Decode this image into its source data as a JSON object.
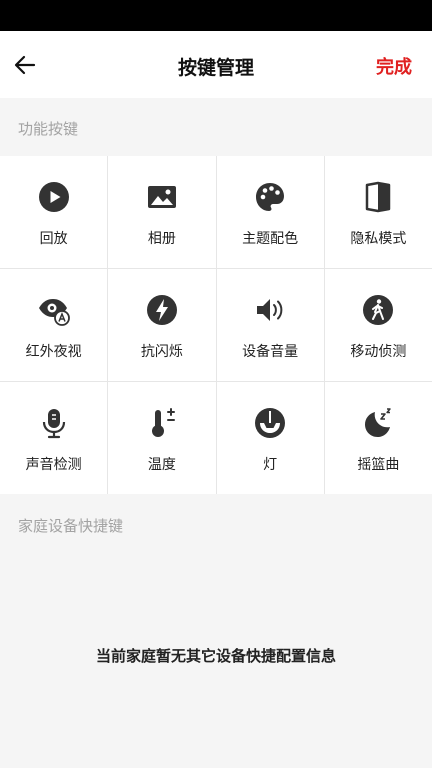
{
  "header": {
    "title": "按键管理",
    "done_label": "完成"
  },
  "colors": {
    "accent": "#e02020",
    "icon": "#333333"
  },
  "sections": {
    "functions_title": "功能按键",
    "shortcuts_title": "家庭设备快捷键"
  },
  "functions": [
    {
      "label": "回放",
      "icon": "play-circle-icon"
    },
    {
      "label": "相册",
      "icon": "photo-album-icon"
    },
    {
      "label": "主题配色",
      "icon": "palette-icon"
    },
    {
      "label": "隐私模式",
      "icon": "privacy-shield-icon"
    },
    {
      "label": "红外夜视",
      "icon": "infrared-night-vision-icon"
    },
    {
      "label": "抗闪烁",
      "icon": "lightning-bolt-icon"
    },
    {
      "label": "设备音量",
      "icon": "speaker-volume-icon"
    },
    {
      "label": "移动侦测",
      "icon": "motion-walk-icon"
    },
    {
      "label": "声音检测",
      "icon": "microphone-icon"
    },
    {
      "label": "温度",
      "icon": "thermometer-icon"
    },
    {
      "label": "灯",
      "icon": "lamp-icon"
    },
    {
      "label": "摇篮曲",
      "icon": "lullaby-moon-icon"
    }
  ],
  "empty_message": "当前家庭暂无其它设备快捷配置信息"
}
